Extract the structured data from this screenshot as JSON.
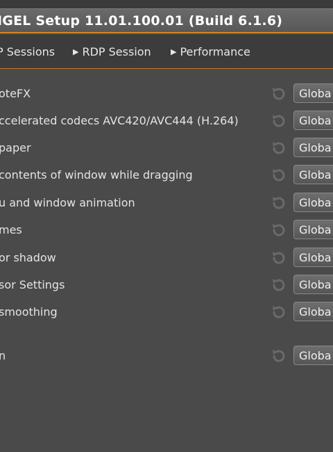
{
  "window": {
    "title": "IGEL Setup 11.01.100.01 (Build 6.1.6)"
  },
  "breadcrumb": [
    {
      "label": "P Sessions"
    },
    {
      "label": "RDP Session"
    },
    {
      "label": "Performance"
    }
  ],
  "settings": [
    {
      "label": "oteFX",
      "button": "Globa"
    },
    {
      "label": "ccelerated codecs AVC420/AVC444 (H.264)",
      "button": "Globa"
    },
    {
      "label": "paper",
      "button": "Globa"
    },
    {
      "label": "contents of window while dragging",
      "button": "Globa"
    },
    {
      "label": "u and window animation",
      "button": "Globa"
    },
    {
      "label": "mes",
      "button": "Globa"
    },
    {
      "label": "or shadow",
      "button": "Globa"
    },
    {
      "label": "sor Settings",
      "button": "Globa"
    },
    {
      "label": "smoothing",
      "button": "Globa"
    },
    {
      "label": "n",
      "button": "Globa"
    }
  ],
  "icons": {
    "reset": "reset-icon",
    "breadcrumb_arrow": "triangle-right-icon"
  },
  "colors": {
    "accent": "#d8851e",
    "background": "#4a4a4a",
    "titlebar": "#5e5e5e"
  }
}
